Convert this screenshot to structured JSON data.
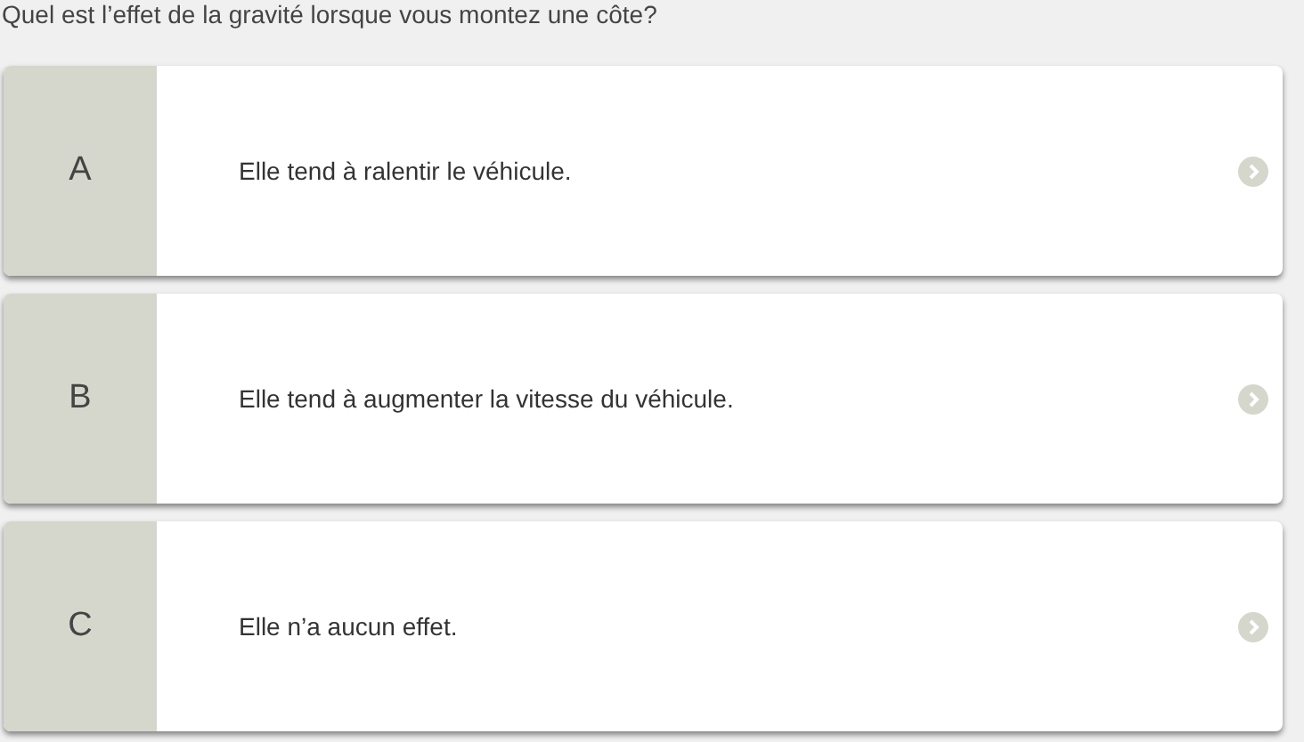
{
  "question": "Quel est l’effet de la gravité lorsque vous montez une côte?",
  "answers": [
    {
      "letter": "A",
      "text": "Elle tend à ralentir le véhicule."
    },
    {
      "letter": "B",
      "text": "Elle tend à augmenter la vitesse du véhicule."
    },
    {
      "letter": "C",
      "text": "Elle n’a aucun effet."
    }
  ]
}
